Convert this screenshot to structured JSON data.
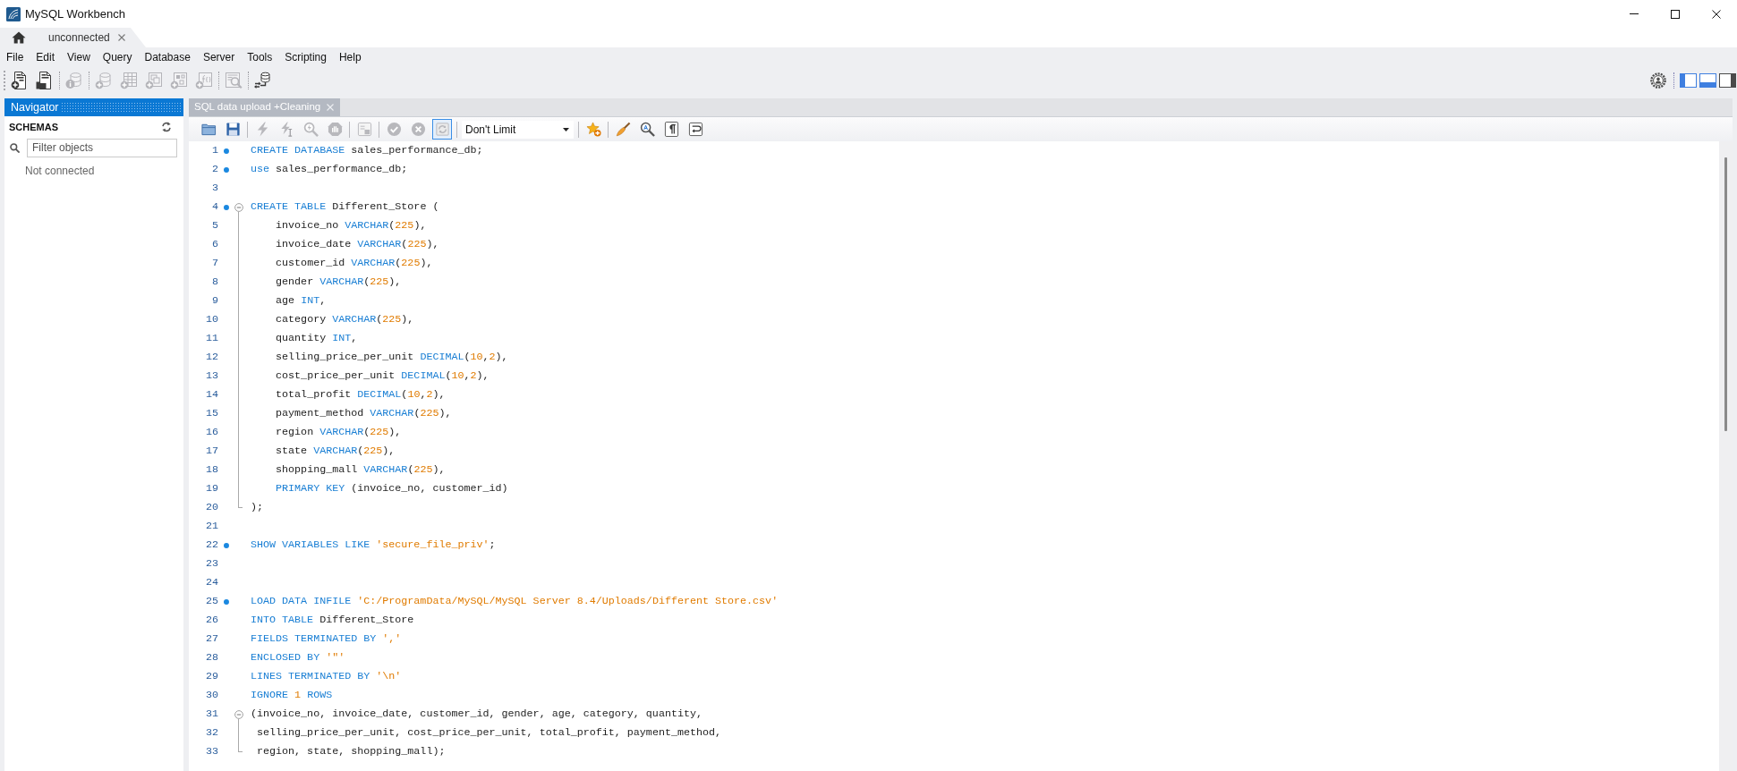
{
  "window": {
    "title": "MySQL Workbench"
  },
  "tabs": [
    {
      "label": "unconnected",
      "selected": true
    }
  ],
  "menu": [
    "File",
    "Edit",
    "View",
    "Query",
    "Database",
    "Server",
    "Tools",
    "Scripting",
    "Help"
  ],
  "toolbar": {
    "groups": [
      [
        {
          "kind": "newsql",
          "disabled": false
        },
        {
          "kind": "opensql",
          "disabled": false
        }
      ],
      [
        {
          "kind": "info",
          "disabled": true
        }
      ],
      [
        {
          "kind": "schema",
          "disabled": true
        },
        {
          "kind": "table",
          "disabled": true
        },
        {
          "kind": "view",
          "disabled": true
        },
        {
          "kind": "procedure",
          "disabled": true
        },
        {
          "kind": "function",
          "disabled": true
        }
      ],
      [
        {
          "kind": "inspector",
          "disabled": true
        }
      ],
      [
        {
          "kind": "reconnect",
          "disabled": false
        }
      ]
    ],
    "panels": [
      {
        "kind": "left",
        "on": true
      },
      {
        "kind": "bottom",
        "on": true
      },
      {
        "kind": "right",
        "on": false
      }
    ]
  },
  "navigator": {
    "title": "Navigator",
    "section": "SCHEMAS",
    "filter": {
      "placeholder": "Filter objects"
    },
    "status": "Not connected"
  },
  "editor": {
    "tabs": [
      {
        "label": "SQL data upload +Cleaning",
        "selected": true
      }
    ],
    "toolbar": [
      [
        {
          "kind": "open",
          "disabled": false
        },
        {
          "kind": "save",
          "disabled": false
        }
      ],
      [
        {
          "kind": "execute",
          "disabled": true
        },
        {
          "kind": "executeline",
          "disabled": true
        },
        {
          "kind": "explain",
          "disabled": true
        },
        {
          "kind": "stop",
          "disabled": true
        }
      ],
      [
        {
          "kind": "output",
          "disabled": true
        }
      ],
      [
        {
          "kind": "commit",
          "disabled": true
        },
        {
          "kind": "rollback",
          "disabled": true
        },
        {
          "kind": "autocommit",
          "disabled": true,
          "on": true
        }
      ],
      [
        {
          "kind": "limit",
          "value": "Don't Limit",
          "disabled": false
        }
      ],
      [
        {
          "kind": "bookmark",
          "disabled": false
        }
      ],
      [
        {
          "kind": "beautify",
          "disabled": false
        },
        {
          "kind": "find",
          "disabled": false
        },
        {
          "kind": "invisibles",
          "disabled": false
        },
        {
          "kind": "wrap",
          "disabled": false
        }
      ]
    ],
    "lines": [
      {
        "number": "1",
        "marker": true,
        "tokens": [
          {
            "kind": "keyword",
            "text": "CREATE DATABASE"
          },
          {
            "kind": "plain",
            "text": " sales_performance_db;"
          }
        ]
      },
      {
        "number": "2",
        "marker": true,
        "tokens": [
          {
            "kind": "keyword",
            "text": "use"
          },
          {
            "kind": "plain",
            "text": " sales_performance_db;"
          }
        ]
      },
      {
        "number": "3",
        "marker": false
      },
      {
        "number": "4",
        "marker": true,
        "expanded": true,
        "tokens": [
          {
            "kind": "keyword",
            "text": "CREATE TABLE"
          },
          {
            "kind": "plain",
            "text": " Different_Store ("
          }
        ],
        "children": [
          {
            "number": "5",
            "marker": false,
            "tokens": [
              {
                "kind": "plain",
                "text": "    invoice_no "
              },
              {
                "kind": "keyword",
                "text": "VARCHAR"
              },
              {
                "kind": "plain",
                "text": "("
              },
              {
                "kind": "number",
                "text": "225"
              },
              {
                "kind": "plain",
                "text": "),"
              }
            ]
          },
          {
            "number": "6",
            "marker": false,
            "tokens": [
              {
                "kind": "plain",
                "text": "    invoice_date "
              },
              {
                "kind": "keyword",
                "text": "VARCHAR"
              },
              {
                "kind": "plain",
                "text": "("
              },
              {
                "kind": "number",
                "text": "225"
              },
              {
                "kind": "plain",
                "text": "),"
              }
            ]
          },
          {
            "number": "7",
            "marker": false,
            "tokens": [
              {
                "kind": "plain",
                "text": "    customer_id "
              },
              {
                "kind": "keyword",
                "text": "VARCHAR"
              },
              {
                "kind": "plain",
                "text": "("
              },
              {
                "kind": "number",
                "text": "225"
              },
              {
                "kind": "plain",
                "text": "),"
              }
            ]
          },
          {
            "number": "8",
            "marker": false,
            "tokens": [
              {
                "kind": "plain",
                "text": "    gender "
              },
              {
                "kind": "keyword",
                "text": "VARCHAR"
              },
              {
                "kind": "plain",
                "text": "("
              },
              {
                "kind": "number",
                "text": "225"
              },
              {
                "kind": "plain",
                "text": "),"
              }
            ]
          },
          {
            "number": "9",
            "marker": false,
            "tokens": [
              {
                "kind": "plain",
                "text": "    age "
              },
              {
                "kind": "keyword",
                "text": "INT"
              },
              {
                "kind": "plain",
                "text": ","
              }
            ]
          },
          {
            "number": "10",
            "marker": false,
            "tokens": [
              {
                "kind": "plain",
                "text": "    category "
              },
              {
                "kind": "keyword",
                "text": "VARCHAR"
              },
              {
                "kind": "plain",
                "text": "("
              },
              {
                "kind": "number",
                "text": "225"
              },
              {
                "kind": "plain",
                "text": "),"
              }
            ]
          },
          {
            "number": "11",
            "marker": false,
            "tokens": [
              {
                "kind": "plain",
                "text": "    quantity "
              },
              {
                "kind": "keyword",
                "text": "INT"
              },
              {
                "kind": "plain",
                "text": ","
              }
            ]
          },
          {
            "number": "12",
            "marker": false,
            "tokens": [
              {
                "kind": "plain",
                "text": "    selling_price_per_unit "
              },
              {
                "kind": "keyword",
                "text": "DECIMAL"
              },
              {
                "kind": "plain",
                "text": "("
              },
              {
                "kind": "number",
                "text": "10"
              },
              {
                "kind": "plain",
                "text": ","
              },
              {
                "kind": "number",
                "text": "2"
              },
              {
                "kind": "plain",
                "text": "),"
              }
            ]
          },
          {
            "number": "13",
            "marker": false,
            "tokens": [
              {
                "kind": "plain",
                "text": "    cost_price_per_unit "
              },
              {
                "kind": "keyword",
                "text": "DECIMAL"
              },
              {
                "kind": "plain",
                "text": "("
              },
              {
                "kind": "number",
                "text": "10"
              },
              {
                "kind": "plain",
                "text": ","
              },
              {
                "kind": "number",
                "text": "2"
              },
              {
                "kind": "plain",
                "text": "),"
              }
            ]
          },
          {
            "number": "14",
            "marker": false,
            "tokens": [
              {
                "kind": "plain",
                "text": "    total_profit "
              },
              {
                "kind": "keyword",
                "text": "DECIMAL"
              },
              {
                "kind": "plain",
                "text": "("
              },
              {
                "kind": "number",
                "text": "10"
              },
              {
                "kind": "plain",
                "text": ","
              },
              {
                "kind": "number",
                "text": "2"
              },
              {
                "kind": "plain",
                "text": "),"
              }
            ]
          },
          {
            "number": "15",
            "marker": false,
            "tokens": [
              {
                "kind": "plain",
                "text": "    payment_method "
              },
              {
                "kind": "keyword",
                "text": "VARCHAR"
              },
              {
                "kind": "plain",
                "text": "("
              },
              {
                "kind": "number",
                "text": "225"
              },
              {
                "kind": "plain",
                "text": "),"
              }
            ]
          },
          {
            "number": "16",
            "marker": false,
            "tokens": [
              {
                "kind": "plain",
                "text": "    region "
              },
              {
                "kind": "keyword",
                "text": "VARCHAR"
              },
              {
                "kind": "plain",
                "text": "("
              },
              {
                "kind": "number",
                "text": "225"
              },
              {
                "kind": "plain",
                "text": "),"
              }
            ]
          },
          {
            "number": "17",
            "marker": false,
            "tokens": [
              {
                "kind": "plain",
                "text": "    state "
              },
              {
                "kind": "keyword",
                "text": "VARCHAR"
              },
              {
                "kind": "plain",
                "text": "("
              },
              {
                "kind": "number",
                "text": "225"
              },
              {
                "kind": "plain",
                "text": "),"
              }
            ]
          },
          {
            "number": "18",
            "marker": false,
            "tokens": [
              {
                "kind": "plain",
                "text": "    shopping_mall "
              },
              {
                "kind": "keyword",
                "text": "VARCHAR"
              },
              {
                "kind": "plain",
                "text": "("
              },
              {
                "kind": "number",
                "text": "225"
              },
              {
                "kind": "plain",
                "text": "),"
              }
            ]
          },
          {
            "number": "19",
            "marker": false,
            "tokens": [
              {
                "kind": "keyword",
                "text": "    PRIMARY KEY"
              },
              {
                "kind": "plain",
                "text": " (invoice_no, customer_id)"
              }
            ]
          },
          {
            "number": "20",
            "marker": false,
            "tokens": [
              {
                "kind": "plain",
                "text": ");"
              }
            ]
          }
        ]
      },
      {
        "number": "21",
        "marker": false
      },
      {
        "number": "22",
        "marker": true,
        "tokens": [
          {
            "kind": "keyword",
            "text": "SHOW VARIABLES LIKE "
          },
          {
            "kind": "string",
            "text": "'secure_file_priv'"
          },
          {
            "kind": "plain",
            "text": ";"
          }
        ]
      },
      {
        "number": "23",
        "marker": false
      },
      {
        "number": "24",
        "marker": false
      },
      {
        "number": "25",
        "marker": true,
        "tokens": [
          {
            "kind": "keyword",
            "text": "LOAD DATA INFILE "
          },
          {
            "kind": "string",
            "text": "'C:/ProgramData/MySQL/MySQL Server 8.4/Uploads/Different Store.csv'"
          }
        ]
      },
      {
        "number": "26",
        "marker": false,
        "tokens": [
          {
            "kind": "keyword",
            "text": "INTO TABLE"
          },
          {
            "kind": "plain",
            "text": " Different_Store"
          }
        ]
      },
      {
        "number": "27",
        "marker": false,
        "tokens": [
          {
            "kind": "keyword",
            "text": "FIELDS TERMINATED BY "
          },
          {
            "kind": "string",
            "text": "','"
          }
        ]
      },
      {
        "number": "28",
        "marker": false,
        "tokens": [
          {
            "kind": "keyword",
            "text": "ENCLOSED BY "
          },
          {
            "kind": "string",
            "text": "'\"'"
          }
        ]
      },
      {
        "number": "29",
        "marker": false,
        "tokens": [
          {
            "kind": "keyword",
            "text": "LINES TERMINATED BY "
          },
          {
            "kind": "string",
            "text": "'\\n'"
          }
        ]
      },
      {
        "number": "30",
        "marker": false,
        "tokens": [
          {
            "kind": "keyword",
            "text": "IGNORE "
          },
          {
            "kind": "number",
            "text": "1"
          },
          {
            "kind": "keyword",
            "text": " ROWS"
          }
        ]
      },
      {
        "number": "31",
        "marker": false,
        "expanded": true,
        "tokens": [
          {
            "kind": "plain",
            "text": "(invoice_no, invoice_date, customer_id, gender, age, category, quantity,"
          }
        ],
        "children": [
          {
            "number": "32",
            "marker": false,
            "tokens": [
              {
                "kind": "plain",
                "text": " selling_price_per_unit, cost_price_per_unit, total_profit, payment_method,"
              }
            ]
          },
          {
            "number": "33",
            "marker": false,
            "tokens": [
              {
                "kind": "plain",
                "text": " region, state, shopping_mall);"
              }
            ]
          }
        ]
      }
    ]
  }
}
